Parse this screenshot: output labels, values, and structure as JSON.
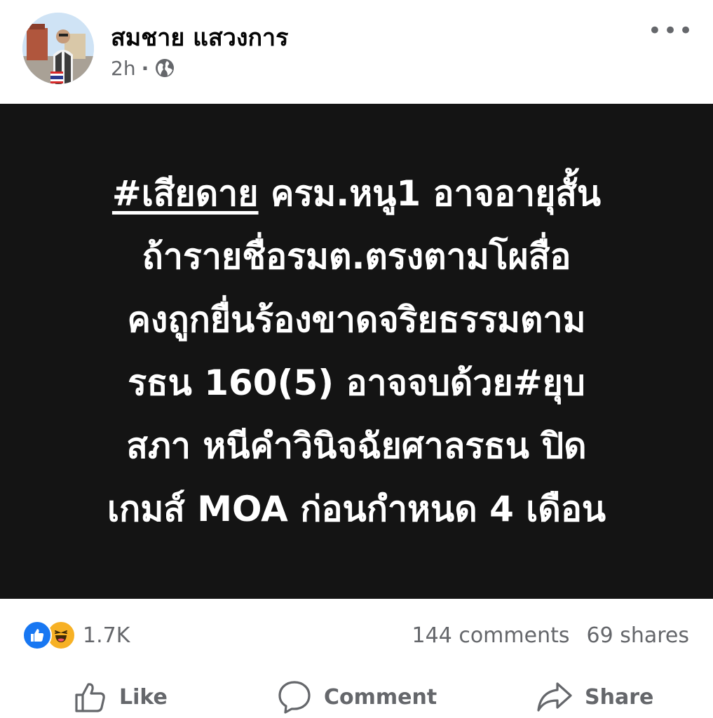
{
  "post": {
    "author": "สมชาย แสวงการ",
    "time": "2h",
    "separator": "·",
    "privacy_icon": "globe-icon",
    "more_label": "•••"
  },
  "image_text": {
    "hashtag_1": "#เสียดาย",
    "line1_rest": " ครม.หนู1 อาจอายุสั้น",
    "line2": "ถ้ารายชื่อรมต.ตรงตามโผสื่อ",
    "line3": "คงถูกยื่นร้องขาดจริยธรรมตาม",
    "line4": "รธน 160(5) อาจจบด้วย#ยุบ",
    "line5": "สภา หนีคำวินิจฉัยศาลรธน ปิด",
    "line6": "เกมส์ MOA ก่อนกำหนด 4 เดือน"
  },
  "stats": {
    "reaction_icons": [
      "like-reaction-icon",
      "haha-reaction-icon"
    ],
    "reactions_count": "1.7K",
    "comments": "144 comments",
    "shares": "69 shares"
  },
  "actions": {
    "like": "Like",
    "comment": "Comment",
    "share": "Share"
  },
  "colors": {
    "secondary_text": "#65676b",
    "image_bg": "#141414",
    "like_blue": "#1877f2",
    "haha_yellow": "#f7b125"
  }
}
